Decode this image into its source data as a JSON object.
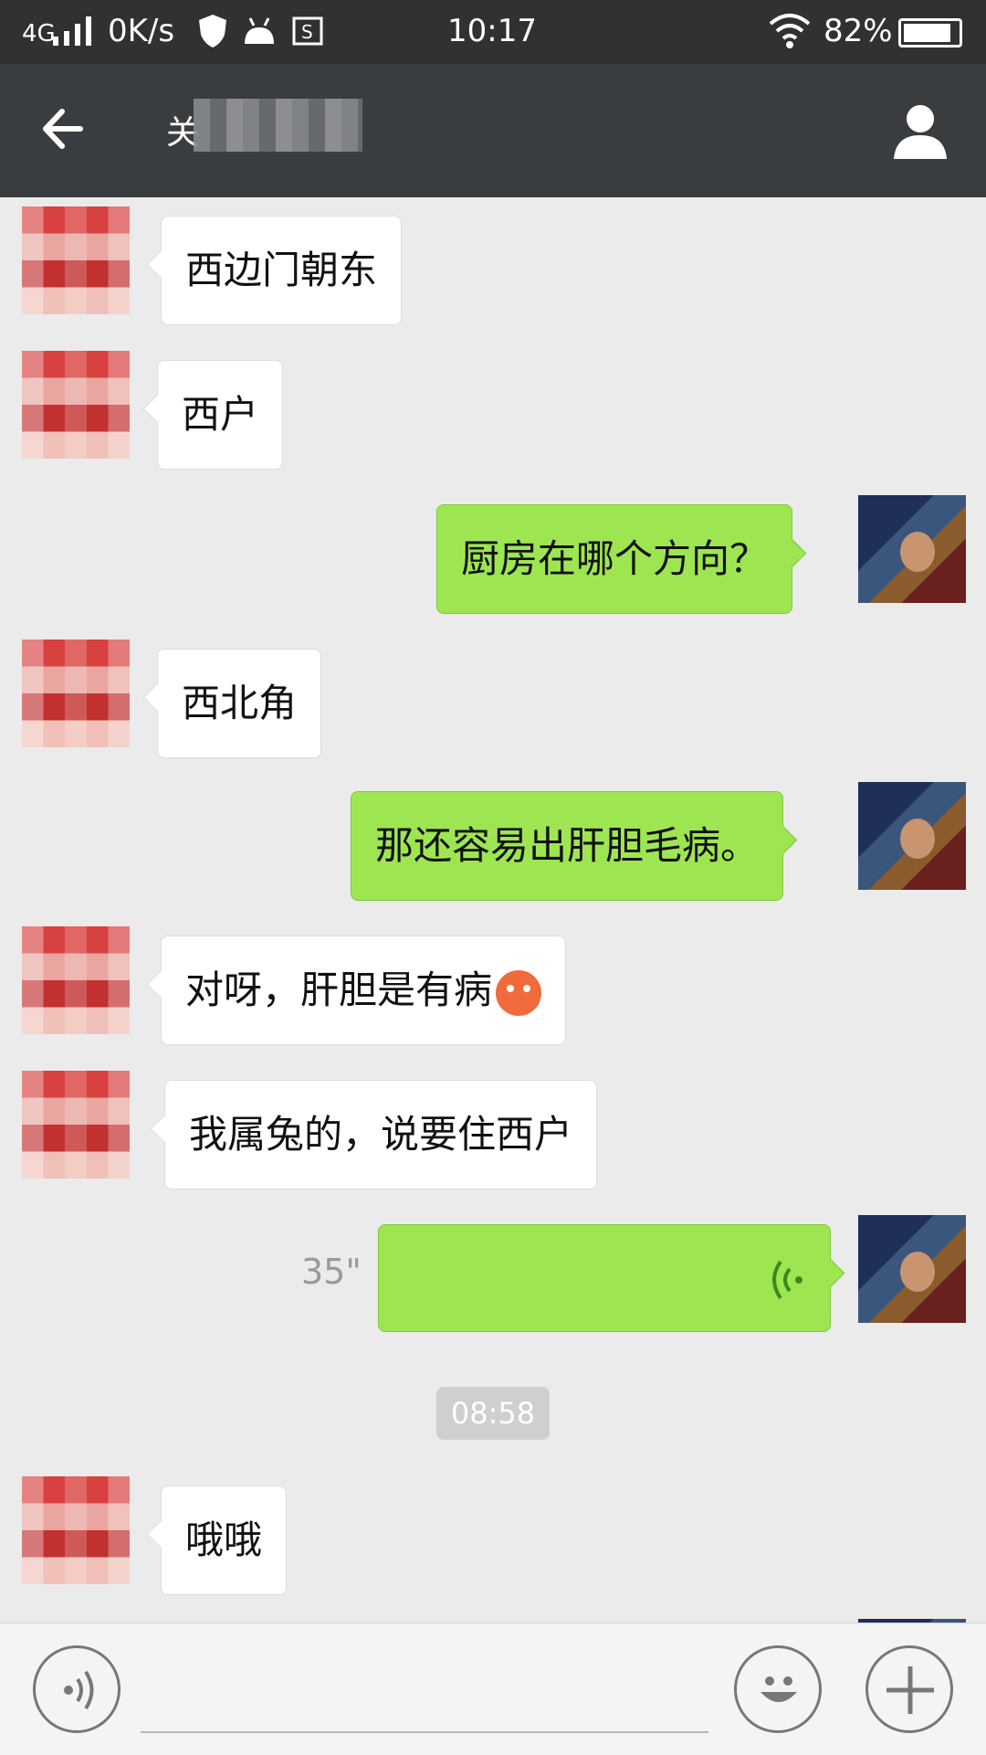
{
  "status_bar": {
    "network": "4G",
    "speed": "0K/s",
    "time": "10:17",
    "battery": "82%"
  },
  "nav": {
    "title": "关",
    "back_icon": "back-arrow-icon",
    "profile_icon": "person-icon"
  },
  "messages": [
    {
      "side": "left",
      "text": "西边门朝东"
    },
    {
      "side": "left",
      "text": "西户"
    },
    {
      "side": "right",
      "text": "厨房在哪个方向？"
    },
    {
      "side": "left",
      "text": "西北角"
    },
    {
      "side": "right",
      "text": "那还容易出肝胆毛病。"
    },
    {
      "side": "left",
      "text": "对呀，肝胆是有病"
    },
    {
      "side": "left",
      "text": "我属兔的，说要住西户"
    },
    {
      "side": "right",
      "type": "voice",
      "duration": "35\""
    },
    {
      "type": "timestamp",
      "text": "08:58"
    },
    {
      "side": "left",
      "text": "哦哦"
    }
  ],
  "colors": {
    "status_bar": "#2f3133",
    "nav_bar": "#3a3d40",
    "chat_bg": "#ebebeb",
    "sent_bubble": "#9de651",
    "received_bubble": "#ffffff"
  },
  "input_bar": {
    "voice_icon": "voice-mode-icon",
    "emoji_icon": "emoji-icon",
    "plus_icon": "plus-icon"
  }
}
